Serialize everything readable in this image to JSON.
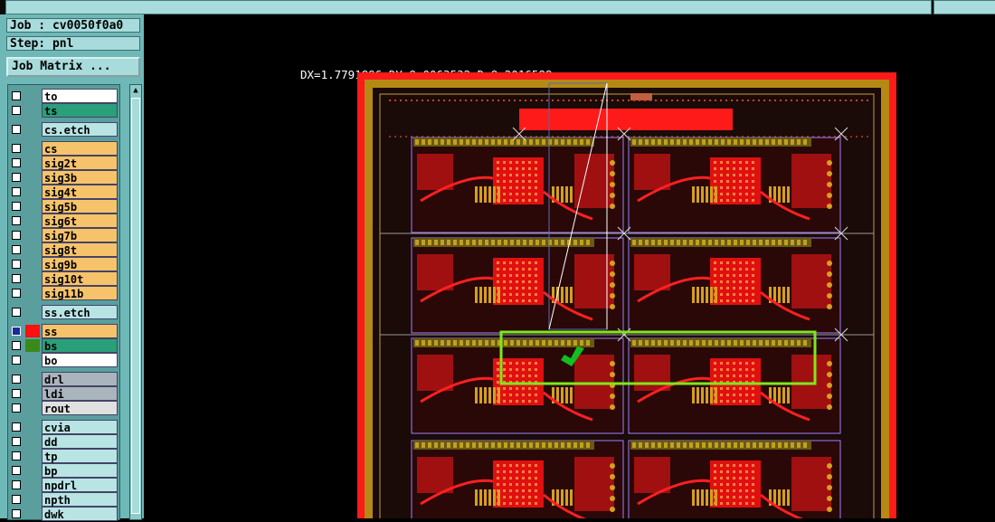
{
  "header": {
    "left_field": "",
    "right_field": ""
  },
  "job": {
    "label": "Job : cv0050f0a0"
  },
  "step": {
    "label": "Step: pnl"
  },
  "job_matrix_button": "Job Matrix ...",
  "layers": [
    {
      "name": "to",
      "color": "#ffffff"
    },
    {
      "name": "ts",
      "color": "#2aa07a",
      "highlight": true
    },
    {
      "name": "cs.etch",
      "color": "#b8e4e4"
    },
    {
      "name": "cs",
      "color": "#f7c36a"
    },
    {
      "name": "sig2t",
      "color": "#f7c36a"
    },
    {
      "name": "sig3b",
      "color": "#f7c36a"
    },
    {
      "name": "sig4t",
      "color": "#f7c36a"
    },
    {
      "name": "sig5b",
      "color": "#f7c36a"
    },
    {
      "name": "sig6t",
      "color": "#f7c36a"
    },
    {
      "name": "sig7b",
      "color": "#f7c36a"
    },
    {
      "name": "sig8t",
      "color": "#f7c36a"
    },
    {
      "name": "sig9b",
      "color": "#f7c36a"
    },
    {
      "name": "sig10t",
      "color": "#f7c36a"
    },
    {
      "name": "sig11b",
      "color": "#f7c36a"
    },
    {
      "name": "ss.etch",
      "color": "#b8e4e4"
    },
    {
      "name": "ss",
      "color": "#f7c36a",
      "swatch": "#ff1010",
      "active": true
    },
    {
      "name": "bs",
      "color": "#2aa07a",
      "swatch": "#3a8a1a"
    },
    {
      "name": "bo",
      "color": "#ffffff"
    },
    {
      "name": "drl",
      "color": "#aab4bc"
    },
    {
      "name": "ldi",
      "color": "#aab4bc"
    },
    {
      "name": "rout",
      "color": "#e0e0e0"
    },
    {
      "name": "cvia",
      "color": "#b8e4e4"
    },
    {
      "name": "dd",
      "color": "#b8e4e4"
    },
    {
      "name": "tp",
      "color": "#b8e4e4"
    },
    {
      "name": "bp",
      "color": "#b8e4e4"
    },
    {
      "name": "npdrl",
      "color": "#b8e4e4"
    },
    {
      "name": "npth",
      "color": "#b8e4e4"
    },
    {
      "name": "dwk",
      "color": "#b8e4e4"
    }
  ],
  "measurement": "DX=1.7791896,DY=8.0063532,D=8.2016588",
  "colors": {
    "board_red": "#ff1a1a",
    "border_gold": "#b48a14",
    "highlight_green": "#7ee81a",
    "outline_purple": "#a080ff"
  }
}
